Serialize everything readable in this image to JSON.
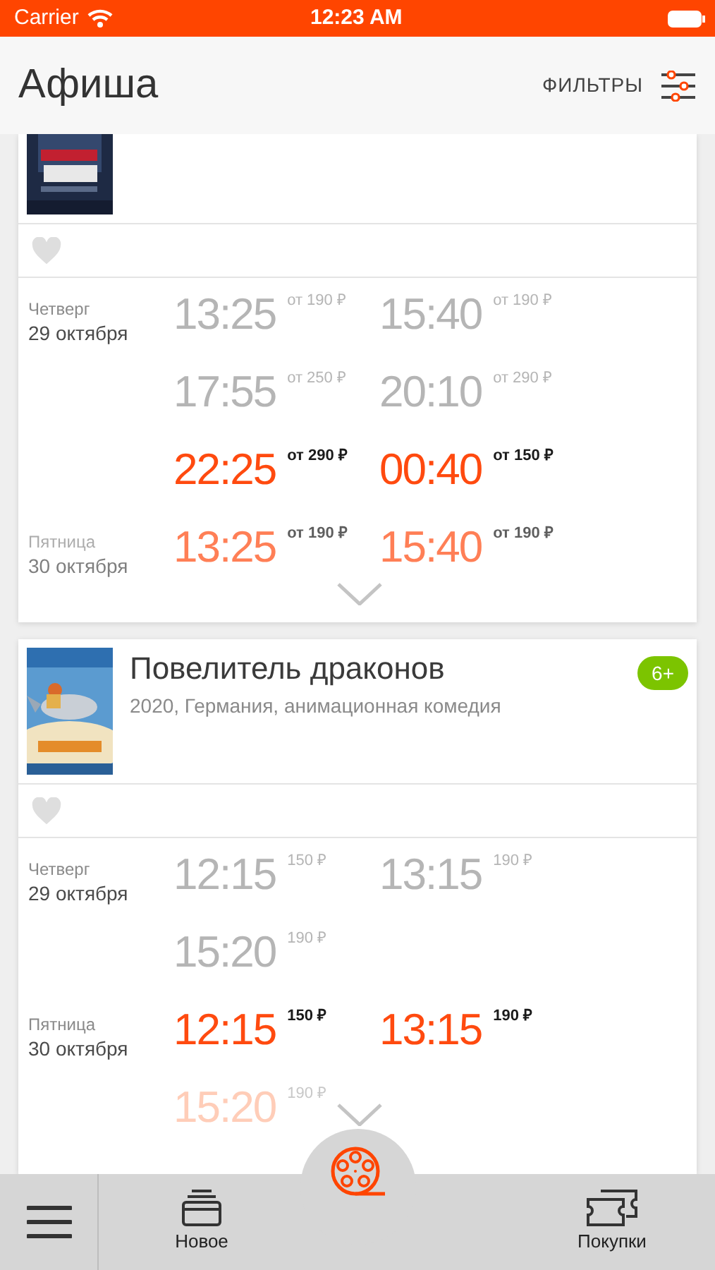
{
  "status_bar": {
    "carrier": "Carrier",
    "time": "12:23 AM"
  },
  "header": {
    "title": "Афиша",
    "filter_label": "ФИЛЬТРЫ"
  },
  "movies": [
    {
      "kind": "scrolled",
      "favorite": false,
      "days": [
        {
          "weekday": "Четверг",
          "date": "29 октября",
          "faded": false,
          "sessions": [
            {
              "time": "13:25",
              "price": "от 190 ₽",
              "kind": "past"
            },
            {
              "time": "15:40",
              "price": "от 190 ₽",
              "kind": "past"
            },
            {
              "time": "17:55",
              "price": "от 250 ₽",
              "kind": "past"
            },
            {
              "time": "20:10",
              "price": "от 290 ₽",
              "kind": "past"
            },
            {
              "time": "22:25",
              "price": "от 290 ₽",
              "kind": "upcoming"
            },
            {
              "time": "00:40",
              "price": "от 150 ₽",
              "kind": "upcoming"
            }
          ]
        },
        {
          "weekday": "Пятница",
          "date": "30 октября",
          "faded": true,
          "sessions": [
            {
              "time": "13:25",
              "price": "от 190 ₽",
              "kind": "upcoming"
            },
            {
              "time": "15:40",
              "price": "от 190 ₽",
              "kind": "upcoming"
            }
          ]
        }
      ]
    },
    {
      "kind": "full",
      "title": "Повелитель драконов",
      "info": "2020, Германия, анимационная комедия",
      "age": "6+",
      "favorite": false,
      "days": [
        {
          "weekday": "Четверг",
          "date": "29 октября",
          "faded": false,
          "sessions": [
            {
              "time": "12:15",
              "price": "150 ₽",
              "kind": "past"
            },
            {
              "time": "13:15",
              "price": "190 ₽",
              "kind": "past"
            },
            {
              "time": "15:20",
              "price": "190 ₽",
              "kind": "past"
            }
          ]
        },
        {
          "weekday": "Пятница",
          "date": "30 октября",
          "faded": false,
          "sessions": [
            {
              "time": "12:15",
              "price": "150 ₽",
              "kind": "upcoming"
            },
            {
              "time": "13:15",
              "price": "190 ₽",
              "kind": "upcoming"
            },
            {
              "time": "15:20",
              "price": "190 ₽",
              "kind": "faded"
            }
          ]
        }
      ]
    }
  ],
  "tab_bar": {
    "tabs": [
      {
        "kind": "new",
        "label": "Новое"
      },
      {
        "kind": "purchases",
        "label": "Покупки"
      }
    ]
  }
}
